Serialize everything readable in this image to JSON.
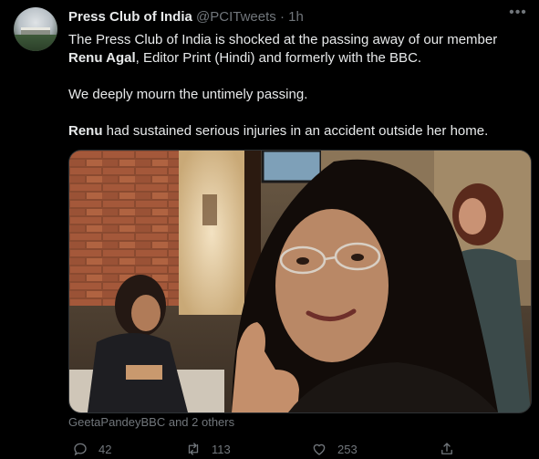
{
  "tweet": {
    "author_name": "Press Club of India",
    "author_handle": "@PCITweets",
    "separator": "·",
    "time": "1h",
    "body": {
      "p1_name": "Renu Agal",
      "p1_pre": "The Press Club of India is shocked at the passing away of our member ",
      "p1_post": ", Editor Print (Hindi) and formerly with the BBC.",
      "p2": "We deeply mourn the untimely passing.",
      "p3_name": "Renu",
      "p3_post": " had sustained serious injuries in an accident outside her home."
    },
    "media_tags": "GeetaPandeyBBC and 2 others",
    "actions": {
      "replies": "42",
      "retweets": "113",
      "likes": "253"
    }
  },
  "icons": [
    "more-icon",
    "reply-icon",
    "retweet-icon",
    "like-icon",
    "share-icon"
  ]
}
